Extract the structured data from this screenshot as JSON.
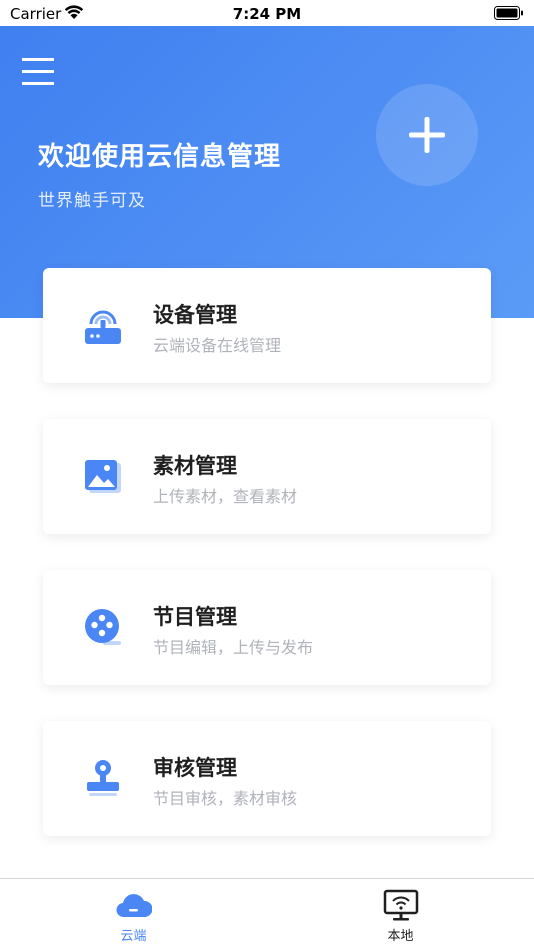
{
  "status_bar": {
    "carrier": "Carrier",
    "time": "7:24 PM"
  },
  "header": {
    "title": "欢迎使用云信息管理",
    "subtitle": "世界触手可及",
    "menu_icon": "hamburger-menu-icon",
    "add_icon": "plus-icon"
  },
  "cards": [
    {
      "title": "设备管理",
      "desc": "云端设备在线管理",
      "icon": "router-icon"
    },
    {
      "title": "素材管理",
      "desc": "上传素材，查看素材",
      "icon": "image-icon"
    },
    {
      "title": "节目管理",
      "desc": "节目编辑，上传与发布",
      "icon": "film-reel-icon"
    },
    {
      "title": "审核管理",
      "desc": "节目审核，素材审核",
      "icon": "stamp-icon"
    }
  ],
  "tabs": [
    {
      "label": "云端",
      "icon": "cloud-icon",
      "active": true
    },
    {
      "label": "本地",
      "icon": "monitor-wifi-icon",
      "active": false
    }
  ],
  "colors": {
    "primary": "#4a86f4",
    "header_start": "#3f7ff0",
    "header_end": "#5b9bf7",
    "desc_text": "#b0b3ba"
  }
}
